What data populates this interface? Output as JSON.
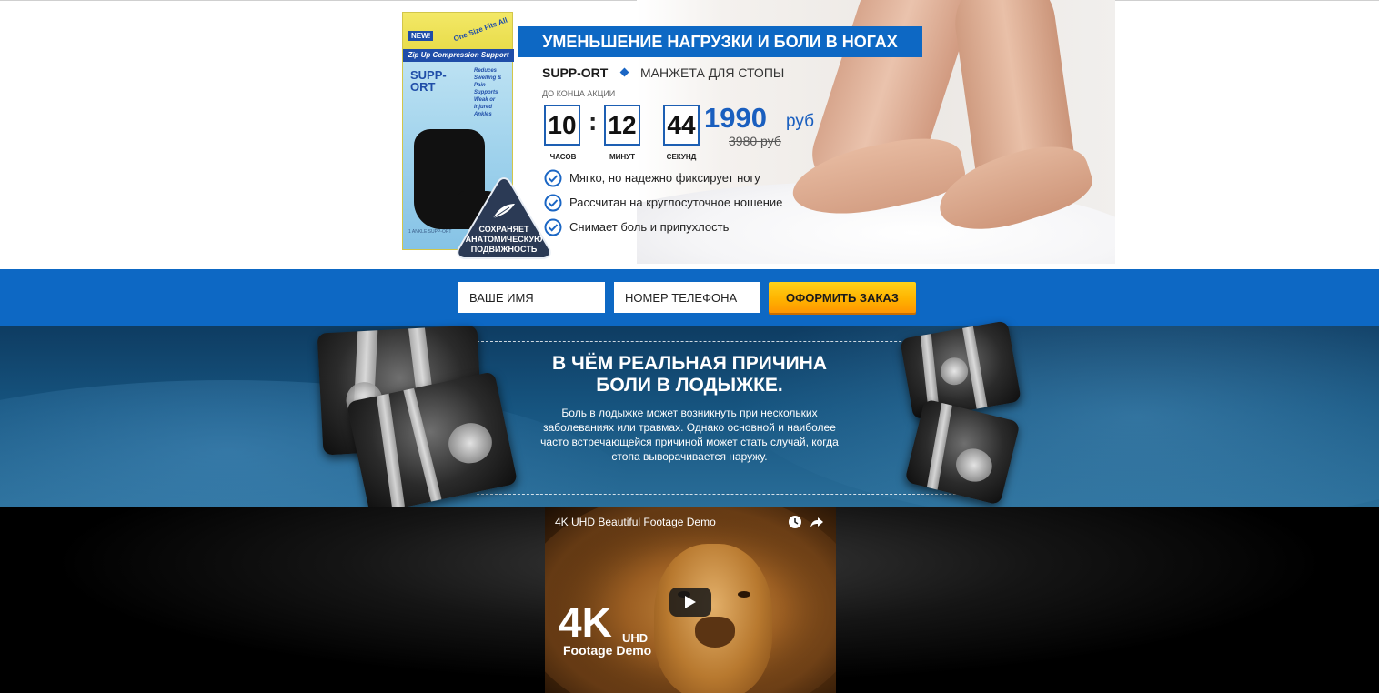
{
  "hero": {
    "headline": "УМЕНЬШЕНИЕ НАГРУЗКИ И БОЛИ В НОГАХ",
    "brand": "SUPP-ORT",
    "subtitle": "МАНЖЕТА ДЛЯ СТОПЫ",
    "timer_caption": "ДО КОНЦА АКЦИИ",
    "timer": {
      "hours": "10",
      "minutes": "12",
      "seconds": "44",
      "hours_label": "ЧАСОВ",
      "minutes_label": "МИНУТ",
      "seconds_label": "СЕКУНД"
    },
    "price": {
      "new": "1990",
      "currency": "руб",
      "old": "3980 руб"
    },
    "features": [
      "Мягко, но надежно фиксирует ногу",
      "Рассчитан на круглосуточное ношение",
      "Снимает боль и припухлость"
    ],
    "badge_lines": [
      "СОХРАНЯЕТ",
      "АНАТОМИЧЕСКУЮ",
      "ПОДВИЖНОСТЬ"
    ],
    "product_box": {
      "new": "NEW!",
      "size": "One Size Fits All",
      "band": "Zip Up Compression Support",
      "brand_line1": "SUPP-",
      "brand_line2": "ORT",
      "bullets": "Reduces Swelling & Pain Supports Weak or Injured Ankles",
      "fineprint": "1 ANKLE SUPP-ORT"
    }
  },
  "order": {
    "name_placeholder": "ВАШЕ ИМЯ",
    "phone_placeholder": "НОМЕР ТЕЛЕФОНА",
    "submit": "ОФОРМИТЬ ЗАКАЗ"
  },
  "cause": {
    "title_line1": "В ЧЁМ РЕАЛЬНАЯ ПРИЧИНА",
    "title_line2": "БОЛИ В ЛОДЫЖКЕ.",
    "description": "Боль в лодыжке может возникнуть при нескольких заболеваниях или травмах. Однако основной и наиболее часто встречающейся причиной может стать случай, когда стопа выворачивается наружу."
  },
  "video": {
    "title": "4K UHD Beautiful Footage Demo",
    "overlay_big": "4K",
    "overlay_uhd": "UHD",
    "overlay_sub": "Footage Demo"
  },
  "colors": {
    "primary_blue": "#0d68c4",
    "order_button": "#ffb300",
    "price_blue": "#1a5fbf"
  },
  "icons": [
    "check-circle-icon",
    "diamond-icon",
    "feather-icon",
    "clock-icon",
    "share-icon",
    "play-icon"
  ]
}
